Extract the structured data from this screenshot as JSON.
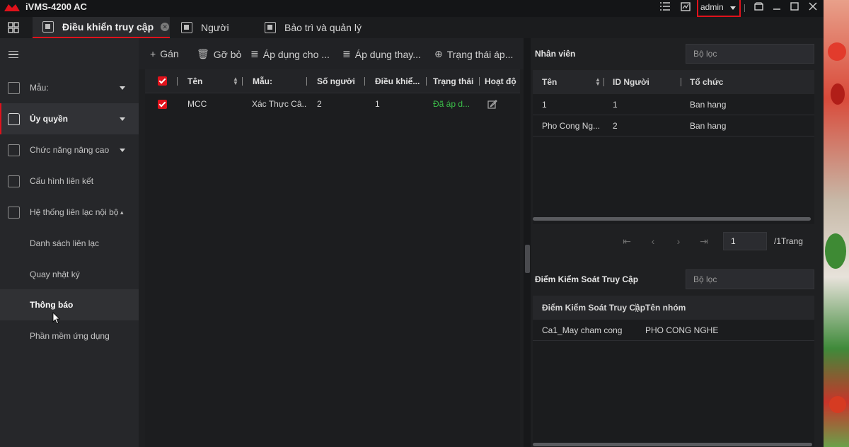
{
  "app": {
    "title": "iVMS-4200 AC",
    "user": "admin"
  },
  "tabs": [
    {
      "label": "Điều khiển truy cập",
      "active": true
    },
    {
      "label": "Người",
      "active": false
    },
    {
      "label": "Bảo trì và quản lý",
      "active": false
    }
  ],
  "sidebar": {
    "items": [
      {
        "label": "Mẫu:",
        "icon": "template-icon",
        "expandable": true
      },
      {
        "label": "Ủy quyền",
        "icon": "lock-icon",
        "expandable": true,
        "active": true
      },
      {
        "label": "Chức năng nâng cao",
        "icon": "advanced-icon",
        "expandable": true
      },
      {
        "label": "Cấu hình liên kết",
        "icon": "link-config-icon",
        "expandable": false
      },
      {
        "label": "Hệ thống liên lạc nội bộ",
        "icon": "intercom-icon",
        "expandable": false
      },
      {
        "label": "Danh sách liên lạc",
        "icon": "",
        "expandable": false
      },
      {
        "label": "Quay nhật ký",
        "icon": "",
        "expandable": false
      },
      {
        "label": "Thông báo",
        "icon": "",
        "expandable": false,
        "highlighted": true
      },
      {
        "label": "Phần mềm ứng dụng",
        "icon": "",
        "expandable": false
      }
    ]
  },
  "toolbar": {
    "assign": "Gán",
    "remove": "Gỡ bỏ",
    "apply_to": "Áp dụng cho ...",
    "apply_change": "Áp dụng thay...",
    "apply_status": "Trạng thái áp..."
  },
  "main_table": {
    "columns": [
      "Tên",
      "Mẫu:",
      "Số người",
      "Điều khiể...",
      "Trạng thái",
      "Hoạt độ"
    ],
    "rows": [
      {
        "name": "MCC",
        "template": "Xác Thực Câ...",
        "persons": "2",
        "control": "1",
        "status": "Đã áp d..."
      }
    ]
  },
  "employees": {
    "title": "Nhân viên",
    "filter_placeholder": "Bộ lọc",
    "columns": [
      "Tên",
      "ID Người",
      "Tổ chức"
    ],
    "rows": [
      {
        "name": "1",
        "id": "1",
        "org": "Ban hang"
      },
      {
        "name": "Pho Cong Ng...",
        "id": "2",
        "org": "Ban hang"
      }
    ],
    "pager": {
      "page": "1",
      "total": "/1Trang"
    }
  },
  "access_points": {
    "title": "Điểm Kiểm Soát Truy Cập",
    "filter_placeholder": "Bộ lọc",
    "columns": [
      "Điểm Kiểm Soát Truy Cập",
      "Tên nhóm"
    ],
    "rows": [
      {
        "point": "Ca1_May cham cong",
        "group": "PHO CONG NGHE"
      }
    ]
  },
  "colors": {
    "accent": "#e0121b",
    "success": "#3cc04a",
    "background": "#1e1f21"
  }
}
